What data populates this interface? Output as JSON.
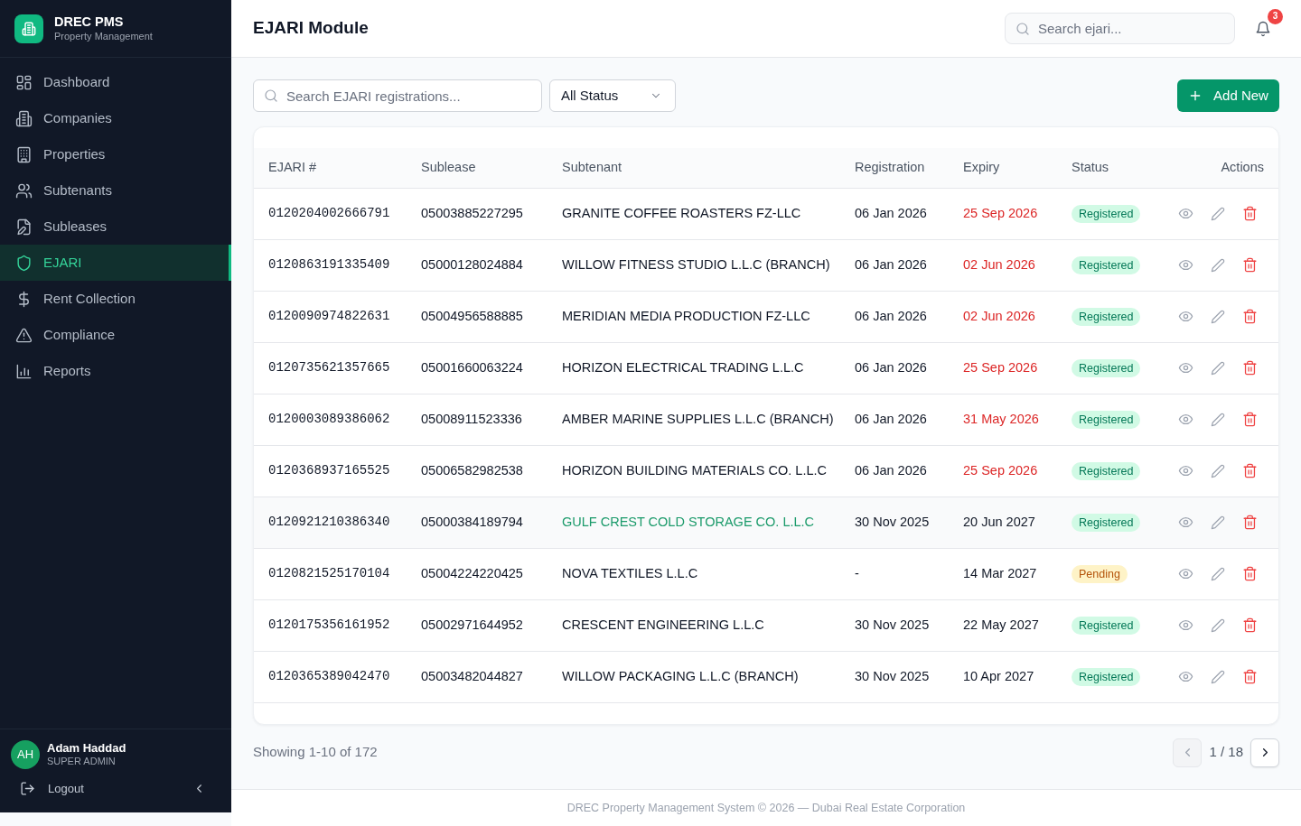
{
  "sidebar": {
    "brand": {
      "title": "DREC PMS",
      "subtitle": "Property Management"
    },
    "items": [
      {
        "label": "Dashboard",
        "selected": false
      },
      {
        "label": "Companies",
        "selected": false
      },
      {
        "label": "Properties",
        "selected": false
      },
      {
        "label": "Subtenants",
        "selected": false
      },
      {
        "label": "Subleases",
        "selected": false
      },
      {
        "label": "EJARI",
        "selected": true
      },
      {
        "label": "Rent Collection",
        "selected": false
      },
      {
        "label": "Compliance",
        "selected": false
      },
      {
        "label": "Reports",
        "selected": false
      }
    ],
    "user": {
      "initials": "AH",
      "name": "Adam Haddad",
      "role": "SUPER ADMIN"
    },
    "logout": "Logout"
  },
  "header": {
    "title": "EJARI Module",
    "search": {
      "placeholder": "Search ejari..."
    },
    "notifications": "3"
  },
  "toolbar": {
    "search": {
      "placeholder": "Search EJARI registrations..."
    },
    "filter": "All Status",
    "add_button": "Add New"
  },
  "table": {
    "columns": [
      "EJARI #",
      "Sublease",
      "Subtenant",
      "Registration",
      "Expiry",
      "Status",
      "Actions"
    ],
    "rows": [
      {
        "ejari": "0120204002666791",
        "sublease": "05003885227295",
        "subtenant": "GRANITE COFFEE ROASTERS FZ-LLC",
        "registration": "06 Jan 2026",
        "expiry": "25 Sep 2026",
        "expiring": true,
        "status": "Registered",
        "kind": "registered",
        "hovered": false
      },
      {
        "ejari": "0120863191335409",
        "sublease": "05000128024884",
        "subtenant": "WILLOW FITNESS STUDIO L.L.C (BRANCH)",
        "registration": "06 Jan 2026",
        "expiry": "02 Jun 2026",
        "expiring": true,
        "status": "Registered",
        "kind": "registered",
        "hovered": false
      },
      {
        "ejari": "0120090974822631",
        "sublease": "05004956588885",
        "subtenant": "MERIDIAN MEDIA PRODUCTION FZ-LLC",
        "registration": "06 Jan 2026",
        "expiry": "02 Jun 2026",
        "expiring": true,
        "status": "Registered",
        "kind": "registered",
        "hovered": false
      },
      {
        "ejari": "0120735621357665",
        "sublease": "05001660063224",
        "subtenant": "HORIZON ELECTRICAL TRADING L.L.C",
        "registration": "06 Jan 2026",
        "expiry": "25 Sep 2026",
        "expiring": true,
        "status": "Registered",
        "kind": "registered",
        "hovered": false
      },
      {
        "ejari": "0120003089386062",
        "sublease": "05008911523336",
        "subtenant": "AMBER MARINE SUPPLIES L.L.C (BRANCH)",
        "registration": "06 Jan 2026",
        "expiry": "31 May 2026",
        "expiring": true,
        "status": "Registered",
        "kind": "registered",
        "hovered": false
      },
      {
        "ejari": "0120368937165525",
        "sublease": "05006582982538",
        "subtenant": "HORIZON BUILDING MATERIALS CO. L.L.C",
        "registration": "06 Jan 2026",
        "expiry": "25 Sep 2026",
        "expiring": true,
        "status": "Registered",
        "kind": "registered",
        "hovered": false
      },
      {
        "ejari": "0120921210386340",
        "sublease": "05000384189794",
        "subtenant": "GULF CREST COLD STORAGE CO. L.L.C",
        "registration": "30 Nov 2025",
        "expiry": "20 Jun 2027",
        "expiring": false,
        "status": "Registered",
        "kind": "registered",
        "hovered": true
      },
      {
        "ejari": "0120821525170104",
        "sublease": "05004224220425",
        "subtenant": "NOVA TEXTILES L.L.C",
        "registration": "-",
        "expiry": "14 Mar 2027",
        "expiring": false,
        "status": "Pending",
        "kind": "pending",
        "hovered": false
      },
      {
        "ejari": "0120175356161952",
        "sublease": "05002971644952",
        "subtenant": "CRESCENT ENGINEERING L.L.C",
        "registration": "30 Nov 2025",
        "expiry": "22 May 2027",
        "expiring": false,
        "status": "Registered",
        "kind": "registered",
        "hovered": false
      },
      {
        "ejari": "0120365389042470",
        "sublease": "05003482044827",
        "subtenant": "WILLOW PACKAGING L.L.C (BRANCH)",
        "registration": "30 Nov 2025",
        "expiry": "10 Apr 2027",
        "expiring": false,
        "status": "Registered",
        "kind": "registered",
        "hovered": false
      }
    ]
  },
  "pagination": {
    "summary": "Showing 1-10 of 172",
    "page": "1 / 18",
    "prev_disabled": true,
    "next_disabled": false
  },
  "footer": "DREC Property Management System © 2026 — Dubai Real Estate Corporation"
}
